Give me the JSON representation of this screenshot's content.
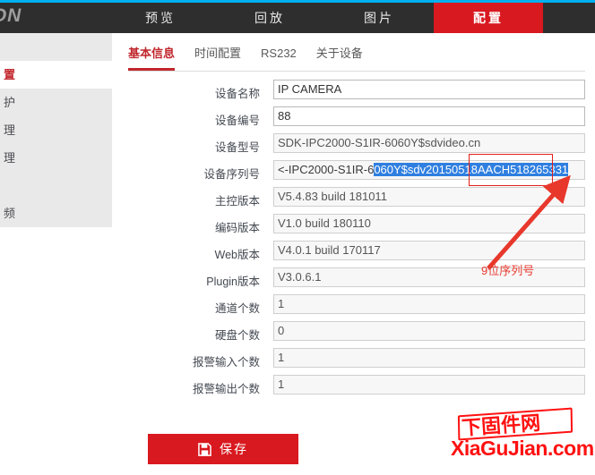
{
  "topnav": {
    "brand": "ION",
    "items": [
      {
        "label": "预览",
        "active": false
      },
      {
        "label": "回放",
        "active": false
      },
      {
        "label": "图片",
        "active": false
      },
      {
        "label": "配置",
        "active": true
      }
    ]
  },
  "sidebar": {
    "items": [
      {
        "label": "",
        "active": false
      },
      {
        "label": "置",
        "active": true
      },
      {
        "label": "护",
        "active": false
      },
      {
        "label": "理",
        "active": false
      },
      {
        "label": "理",
        "active": false
      },
      {
        "label": "",
        "active": false
      },
      {
        "label": "频",
        "active": false
      }
    ]
  },
  "subtabs": [
    {
      "label": "基本信息",
      "active": true
    },
    {
      "label": "时间配置",
      "active": false
    },
    {
      "label": "RS232",
      "active": false
    },
    {
      "label": "关于设备",
      "active": false
    }
  ],
  "form": {
    "rows": [
      {
        "label": "设备名称",
        "value": "IP CAMERA",
        "readonly": false
      },
      {
        "label": "设备编号",
        "value": "88",
        "readonly": false
      },
      {
        "label": "设备型号",
        "value": "SDK-IPC2000-S1IR-6060Y$sdvideo.cn",
        "readonly": true
      },
      {
        "label": "设备序列号",
        "value": "<-IPC2000-S1IR-6060Y$sdv20150518AACH518265331",
        "readonly": true
      },
      {
        "label": "主控版本",
        "value": "V5.4.83 build 181011",
        "readonly": true
      },
      {
        "label": "编码版本",
        "value": "V1.0 build 180110",
        "readonly": true
      },
      {
        "label": "Web版本",
        "value": "V4.0.1 build 170117",
        "readonly": true
      },
      {
        "label": "Plugin版本",
        "value": "V3.0.6.1",
        "readonly": true
      },
      {
        "label": "通道个数",
        "value": "1",
        "readonly": true
      },
      {
        "label": "硬盘个数",
        "value": "0",
        "readonly": true
      },
      {
        "label": "报警输入个数",
        "value": "1",
        "readonly": true
      },
      {
        "label": "报警输出个数",
        "value": "1",
        "readonly": true
      }
    ],
    "serial": {
      "prefix": "<-IPC2000-S1IR-6",
      "selected": "060Y$sdv20150518AACH",
      "boxed": "518265331"
    }
  },
  "annotation": {
    "text": "9位序列号"
  },
  "save": {
    "label": "保存",
    "icon": "save-icon"
  },
  "watermark": {
    "cn": "下固件网",
    "en": "XiaGuJian.com"
  },
  "colors": {
    "accent_red": "#d8191f",
    "nav_dark": "#2e2e2e",
    "top_strip": "#00b0f0",
    "selection_blue": "#2f7fe0",
    "annotation_red": "#e83b30",
    "sidebar_bg": "#e9e9e9"
  }
}
